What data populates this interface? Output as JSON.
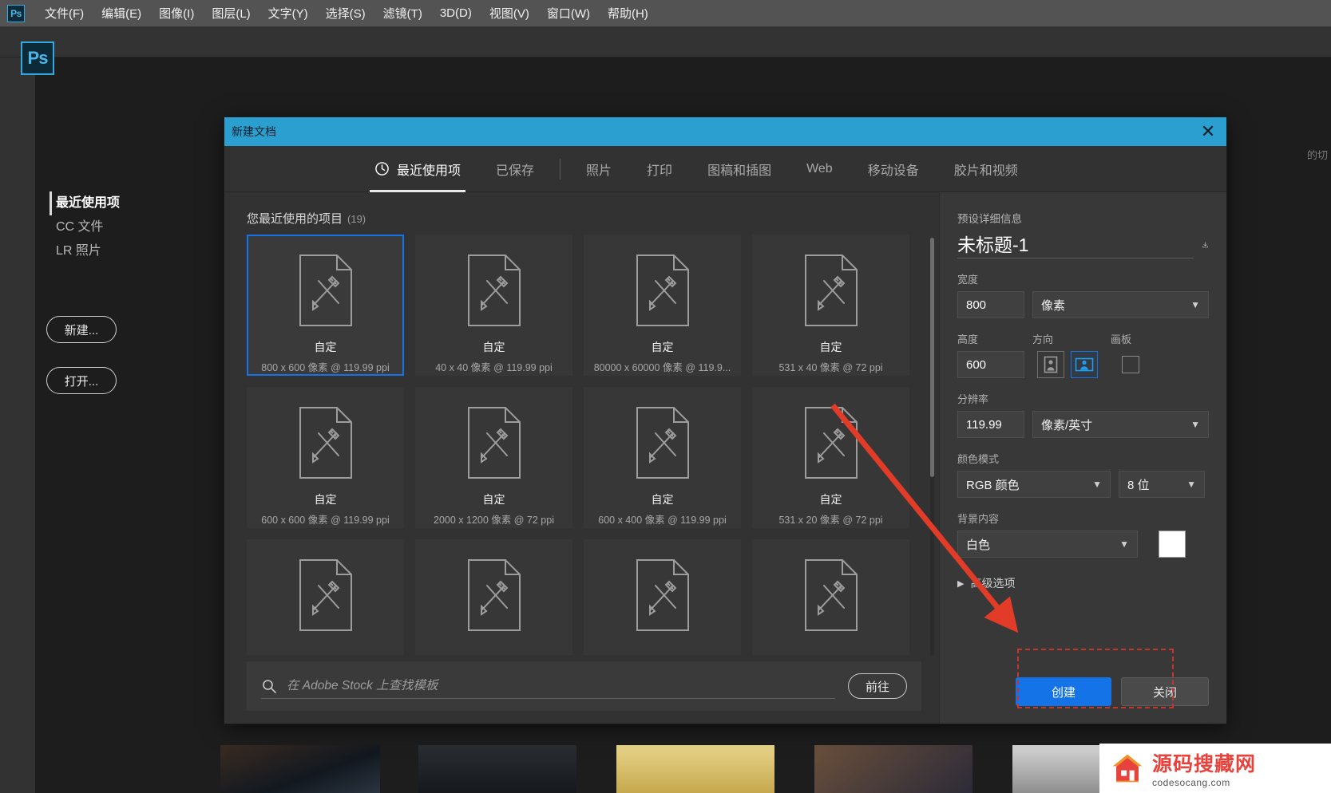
{
  "app": {
    "logo_label": "Ps",
    "menu_items": [
      "文件(F)",
      "编辑(E)",
      "图像(I)",
      "图层(L)",
      "文字(Y)",
      "选择(S)",
      "滤镜(T)",
      "3D(D)",
      "视图(V)",
      "窗口(W)",
      "帮助(H)"
    ],
    "background_hint": "的切"
  },
  "home": {
    "nav": [
      {
        "label": "最近使用项",
        "active": true
      },
      {
        "label": "CC 文件",
        "active": false
      },
      {
        "label": "LR 照片",
        "active": false
      }
    ],
    "new_button": "新建...",
    "open_button": "打开..."
  },
  "dialog": {
    "title": "新建文档",
    "close_icon": "close-icon",
    "tabs": [
      {
        "label": "最近使用项",
        "active": true,
        "icon": "clock-icon"
      },
      {
        "label": "已保存",
        "active": false
      },
      {
        "label": "照片",
        "active": false
      },
      {
        "label": "打印",
        "active": false
      },
      {
        "label": "图稿和插图",
        "active": false
      },
      {
        "label": "Web",
        "active": false
      },
      {
        "label": "移动设备",
        "active": false
      },
      {
        "label": "胶片和视频",
        "active": false
      }
    ],
    "templates": {
      "heading": "您最近使用的项目",
      "count": "(19)",
      "items": [
        {
          "name": "自定",
          "dims": "800 x 600 像素 @ 119.99 ppi",
          "selected": true
        },
        {
          "name": "自定",
          "dims": "40 x 40 像素 @ 119.99 ppi",
          "selected": false
        },
        {
          "name": "自定",
          "dims": "80000 x 60000 像素 @ 119.9...",
          "selected": false
        },
        {
          "name": "自定",
          "dims": "531 x 40 像素 @ 72 ppi",
          "selected": false
        },
        {
          "name": "自定",
          "dims": "600 x 600 像素 @ 119.99 ppi",
          "selected": false
        },
        {
          "name": "自定",
          "dims": "2000 x 1200 像素 @ 72 ppi",
          "selected": false
        },
        {
          "name": "自定",
          "dims": "600 x 400 像素 @ 119.99 ppi",
          "selected": false
        },
        {
          "name": "自定",
          "dims": "531 x 20 像素 @ 72 ppi",
          "selected": false
        },
        {
          "name": "",
          "dims": "",
          "selected": false
        },
        {
          "name": "",
          "dims": "",
          "selected": false
        },
        {
          "name": "",
          "dims": "",
          "selected": false
        },
        {
          "name": "",
          "dims": "",
          "selected": false
        }
      ]
    },
    "stock": {
      "placeholder": "在 Adobe Stock 上查找模板",
      "value": "",
      "goto_label": "前往",
      "search_icon": "search-icon"
    },
    "details": {
      "section_title": "预设详细信息",
      "doc_name": "未标题-1",
      "save_preset_icon": "save-preset-icon",
      "width_label": "宽度",
      "width_value": "800",
      "width_unit": "像素",
      "height_label": "高度",
      "height_value": "600",
      "orientation_label": "方向",
      "orientation_portrait_icon": "portrait-orientation-icon",
      "orientation_landscape_icon": "landscape-orientation-icon",
      "orientation_selected": "landscape",
      "artboard_label": "画板",
      "artboard_checked": false,
      "resolution_label": "分辨率",
      "resolution_value": "119.99",
      "resolution_unit": "像素/英寸",
      "colormode_label": "颜色模式",
      "colormode_value": "RGB 颜色",
      "colordepth_value": "8 位",
      "background_label": "背景内容",
      "background_value": "白色",
      "background_swatch": "#ffffff",
      "advanced_label": "高级选项",
      "create_label": "创建",
      "close_label": "关闭"
    }
  },
  "watermark": {
    "title": "源码搜藏网",
    "subtitle": "codesocang.com"
  },
  "colors": {
    "accent_blue": "#1473e6",
    "titlebar_blue": "#2a9fd0",
    "annotation_red": "#e23b28",
    "dialog_bg": "#323232",
    "detail_bg": "#383838"
  }
}
